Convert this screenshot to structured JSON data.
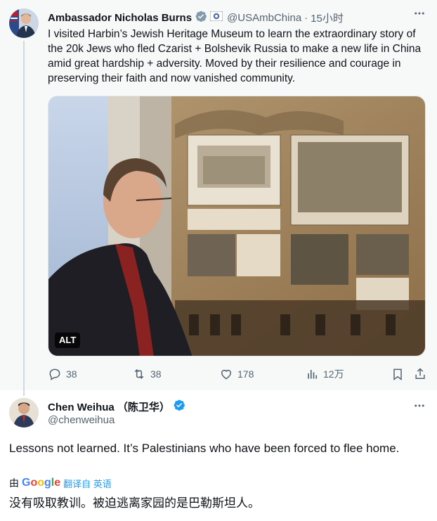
{
  "tweet": {
    "author_name": "Ambassador Nicholas Burns",
    "handle": "@USAmbChina",
    "separator": "·",
    "time": "15小时",
    "text": "I visited Harbin’s Jewish Heritage Museum to learn the extraordinary story of the 20k Jews who fled Czarist + Bolshevik Russia to make a new life in China amid great hardship + adversity. Moved by their resilience and courage in preserving their faith and now vanished community.",
    "media": {
      "alt_badge": "ALT"
    },
    "stats": {
      "replies": "38",
      "retweets": "38",
      "likes": "178",
      "views": "12万"
    }
  },
  "reply": {
    "author_name": "Chen Weihua （陈卫华）",
    "handle": "@chenweihua",
    "text": "Lessons not learned. It’s Palestinians who have been forced to flee home.",
    "translation_by": "由",
    "translation_source": "Google",
    "translation_label": "翻译自 英语",
    "translated_text": "没有吸取教训。被迫逃离家园的是巴勒斯坦人。"
  },
  "colors": {
    "verified": "#1d9bf0",
    "muted": "#536471",
    "text": "#0f1419",
    "link": "#1d9bf0"
  }
}
